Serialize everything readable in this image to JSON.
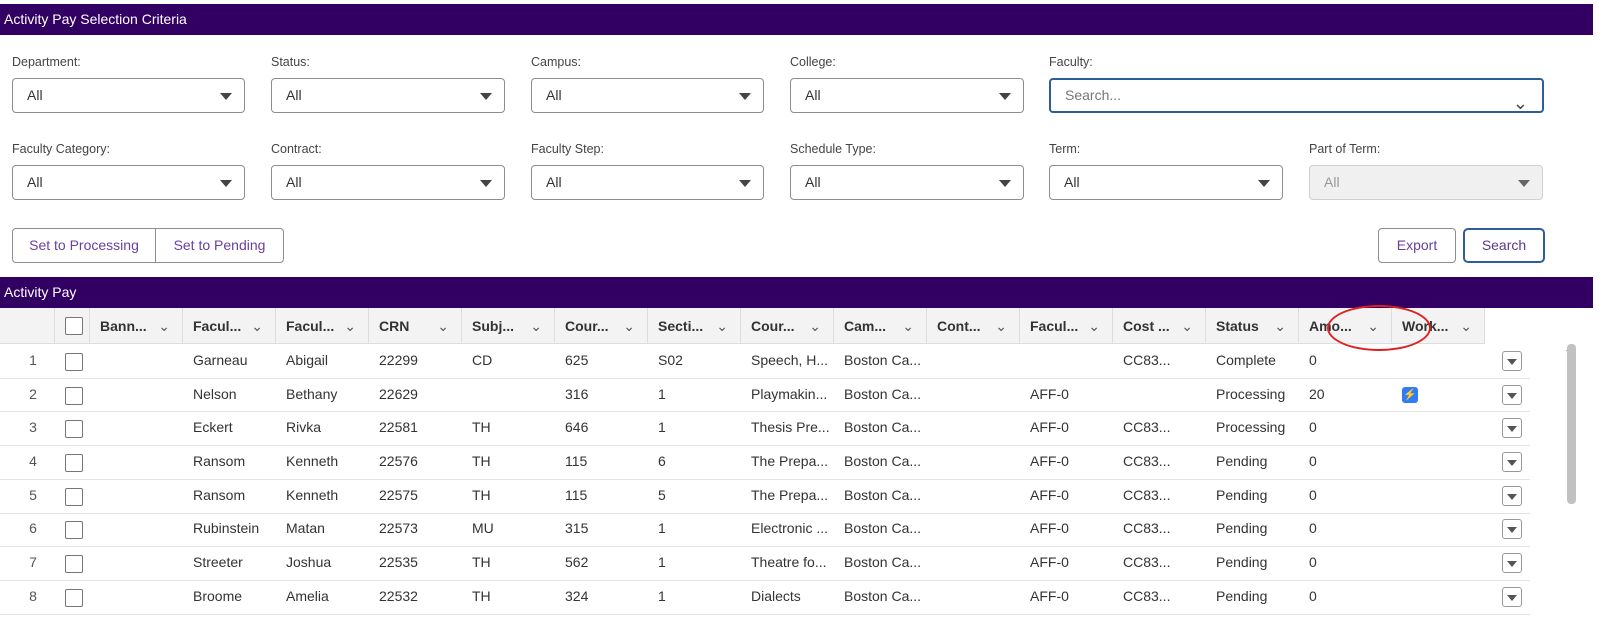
{
  "criteria": {
    "title": "Activity Pay Selection Criteria",
    "fields": [
      {
        "label": "Department:",
        "value": "All"
      },
      {
        "label": "Status:",
        "value": "All"
      },
      {
        "label": "Campus:",
        "value": "All"
      },
      {
        "label": "College:",
        "value": "All"
      },
      {
        "label": "Faculty:",
        "placeholder": "Search..."
      },
      {
        "label": "Faculty Category:",
        "value": "All"
      },
      {
        "label": "Contract:",
        "value": "All"
      },
      {
        "label": "Faculty Step:",
        "value": "All"
      },
      {
        "label": "Schedule Type:",
        "value": "All"
      },
      {
        "label": "Term:",
        "value": "All"
      },
      {
        "label": "Part of Term:",
        "value": "All"
      }
    ],
    "buttons": {
      "set_processing": "Set to Processing",
      "set_pending": "Set to Pending",
      "export": "Export",
      "search": "Search"
    }
  },
  "grid": {
    "title": "Activity Pay",
    "columns": [
      "Bann...",
      "Facul...",
      "Facul...",
      "CRN",
      "Subj...",
      "Cour...",
      "Secti...",
      "Cour...",
      "Cam...",
      "Cont...",
      "Facul...",
      "Cost ...",
      "Status",
      "Amo...",
      "Work..."
    ],
    "rows": [
      [
        "1",
        "",
        "Garneau",
        "Abigail",
        "22299",
        "CD",
        "625",
        "S02",
        "Speech, H...",
        "Boston Ca...",
        "",
        "",
        "CC83...",
        "Complete",
        "0"
      ],
      [
        "2",
        "",
        "Nelson",
        "Bethany",
        "22629",
        "",
        "316",
        "1",
        "Playmakin...",
        "Boston Ca...",
        "",
        "AFF-0",
        "",
        "Processing",
        "20"
      ],
      [
        "3",
        "",
        "Eckert",
        "Rivka",
        "22581",
        "TH",
        "646",
        "1",
        "Thesis Pre...",
        "Boston Ca...",
        "",
        "AFF-0",
        "CC83...",
        "Processing",
        "0"
      ],
      [
        "4",
        "",
        "Ransom",
        "Kenneth",
        "22576",
        "TH",
        "115",
        "6",
        "The Prepa...",
        "Boston Ca...",
        "",
        "AFF-0",
        "CC83...",
        "Pending",
        "0"
      ],
      [
        "5",
        "",
        "Ransom",
        "Kenneth",
        "22575",
        "TH",
        "115",
        "5",
        "The Prepa...",
        "Boston Ca...",
        "",
        "AFF-0",
        "CC83...",
        "Pending",
        "0"
      ],
      [
        "6",
        "",
        "Rubinstein",
        "Matan",
        "22573",
        "MU",
        "315",
        "1",
        "Electronic ...",
        "Boston Ca...",
        "",
        "AFF-0",
        "CC83...",
        "Pending",
        "0"
      ],
      [
        "7",
        "",
        "Streeter",
        "Joshua",
        "22535",
        "TH",
        "562",
        "1",
        "Theatre fo...",
        "Boston Ca...",
        "",
        "AFF-0",
        "CC83...",
        "Pending",
        "0"
      ],
      [
        "8",
        "",
        "Broome",
        "Amelia",
        "22532",
        "TH",
        "324",
        "1",
        "Dialects",
        "Boston Ca...",
        "",
        "AFF-0",
        "CC83...",
        "Pending",
        "0"
      ]
    ],
    "workflow_icon_row": 2,
    "workflow_icon": "lightning-bolt-icon",
    "accent_color": "#310062"
  }
}
